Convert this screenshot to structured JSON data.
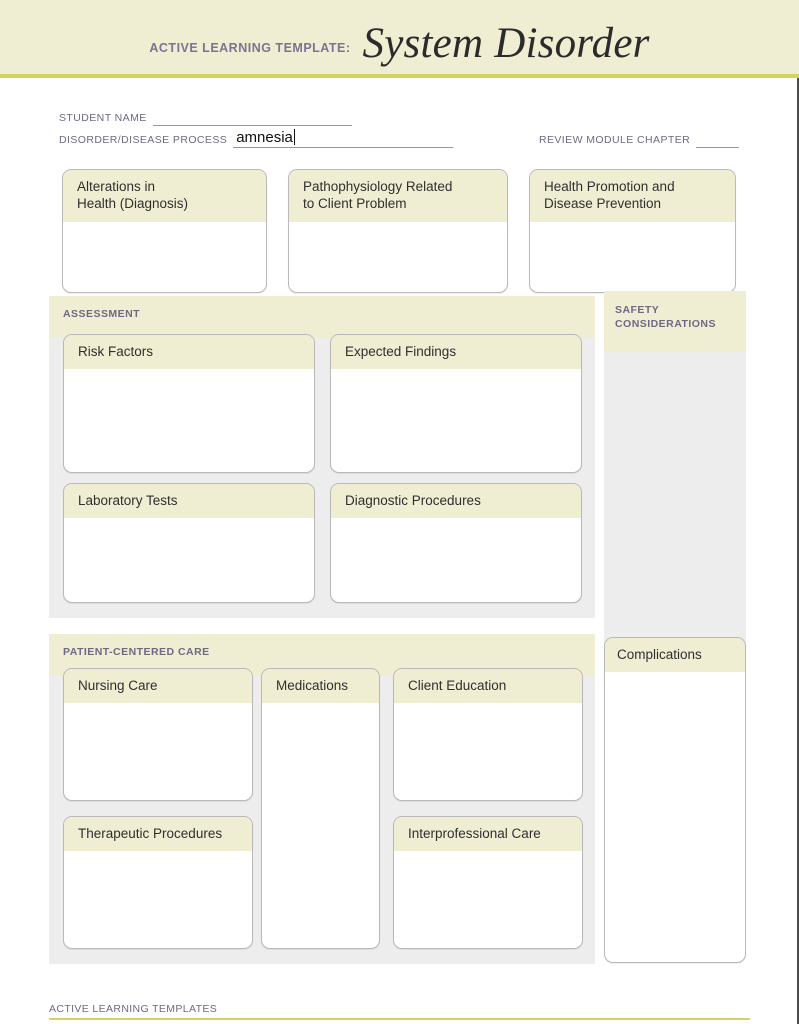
{
  "masthead": {
    "label": "ACTIVE LEARNING TEMPLATE:",
    "title": "System Disorder",
    "band_color": "#efeed3",
    "rule_color": "#d3d264",
    "label_color": "#7b7392"
  },
  "fields": {
    "student_name_label": "STUDENT NAME",
    "student_name_value": "",
    "disorder_label": "DISORDER/DISEASE PROCESS",
    "disorder_value": "amnesia",
    "review_module_label": "REVIEW MODULE CHAPTER",
    "review_module_value": ""
  },
  "top_cards": [
    {
      "title": "Alterations in\nHealth (Diagnosis)",
      "content": ""
    },
    {
      "title": "Pathophysiology Related\nto Client Problem",
      "content": ""
    },
    {
      "title": "Health Promotion and\nDisease Prevention",
      "content": ""
    }
  ],
  "assessment": {
    "heading": "ASSESSMENT",
    "cards": [
      {
        "title": "Risk Factors",
        "content": ""
      },
      {
        "title": "Expected Findings",
        "content": ""
      },
      {
        "title": "Laboratory Tests",
        "content": ""
      },
      {
        "title": "Diagnostic Procedures",
        "content": ""
      }
    ]
  },
  "patient_centered_care": {
    "heading": "PATIENT-CENTERED CARE",
    "cards": [
      {
        "title": "Nursing Care",
        "content": ""
      },
      {
        "title": "Medications",
        "content": ""
      },
      {
        "title": "Client Education",
        "content": ""
      },
      {
        "title": "Therapeutic Procedures",
        "content": ""
      },
      {
        "title": "Interprofessional Care",
        "content": ""
      }
    ]
  },
  "safety": {
    "heading": "SAFETY\nCONSIDERATIONS",
    "content": ""
  },
  "complications": {
    "title": "Complications",
    "content": ""
  },
  "footer": {
    "text": "ACTIVE LEARNING TEMPLATES",
    "rule_color": "#d3d264"
  }
}
